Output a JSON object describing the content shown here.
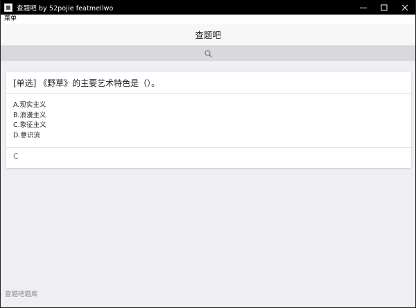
{
  "window": {
    "title": "查题吧 by 52pojie featmellwo"
  },
  "menu": {
    "label": "菜单"
  },
  "header": {
    "title": "查题吧"
  },
  "search": {
    "icon": "search-icon"
  },
  "card": {
    "question": "[单选] 《野草》的主要艺术特色是（）。",
    "options": [
      "A.现实主义",
      "B.浪漫主义",
      "C.象征主义",
      "D.意识流"
    ],
    "answer": "C"
  },
  "footer": {
    "label": "查题吧题库"
  },
  "colors": {
    "titlebar": "#000000",
    "background": "#efeef3",
    "searchbar": "#d8d8dd",
    "card": "#ffffff"
  }
}
